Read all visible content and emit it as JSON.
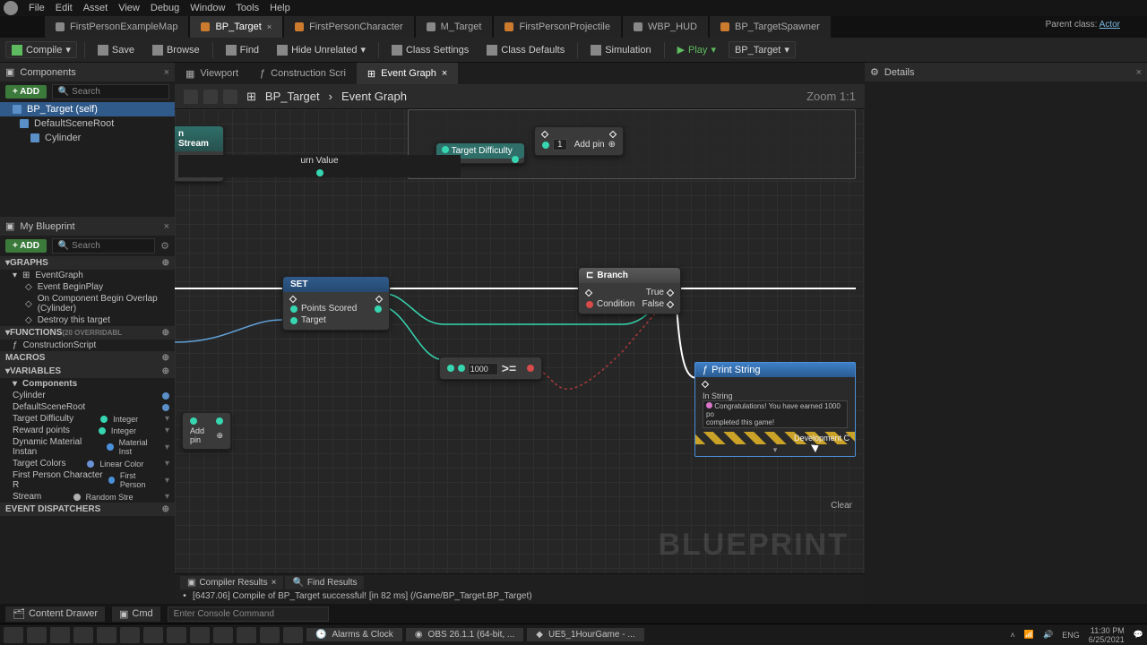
{
  "menu": [
    "File",
    "Edit",
    "Asset",
    "View",
    "Debug",
    "Window",
    "Tools",
    "Help"
  ],
  "tabs": [
    {
      "label": "FirstPersonExampleMap"
    },
    {
      "label": "BP_Target",
      "active": true,
      "closable": true
    },
    {
      "label": "FirstPersonCharacter"
    },
    {
      "label": "M_Target"
    },
    {
      "label": "FirstPersonProjectile"
    },
    {
      "label": "WBP_HUD"
    },
    {
      "label": "BP_TargetSpawner"
    }
  ],
  "parentclass": {
    "label": "Parent class:",
    "value": "Actor"
  },
  "toolbar": {
    "compile": "Compile",
    "save": "Save",
    "browse": "Browse",
    "find": "Find",
    "hide": "Hide Unrelated",
    "class_settings": "Class Settings",
    "class_defaults": "Class Defaults",
    "simulation": "Simulation",
    "play": "Play",
    "target_select": "BP_Target"
  },
  "components": {
    "title": "Components",
    "add": "ADD",
    "search_ph": "Search",
    "items": [
      {
        "label": "BP_Target (self)"
      },
      {
        "label": "DefaultSceneRoot"
      },
      {
        "label": "Cylinder",
        "indent": true
      }
    ]
  },
  "myblueprint": {
    "title": "My Blueprint",
    "add": "ADD",
    "search_ph": "Search",
    "graphs": {
      "head": "GRAPHS",
      "items": [
        "EventGraph",
        "Event BeginPlay",
        "On Component Begin Overlap (Cylinder)",
        "Destroy this target"
      ]
    },
    "functions": {
      "head": "FUNCTIONS",
      "hint": "(20 OVERRIDABL",
      "items": [
        "ConstructionScript"
      ]
    },
    "macros": {
      "head": "MACROS"
    },
    "variables": {
      "head": "VARIABLES",
      "comp": {
        "head": "Components",
        "items": [
          "Cylinder",
          "DefaultSceneRoot"
        ]
      },
      "vars": [
        {
          "name": "Target Difficulty",
          "type": "Integer",
          "dot": "int"
        },
        {
          "name": "Reward points",
          "type": "Integer",
          "dot": "int"
        },
        {
          "name": "Dynamic Material Instan",
          "type": "Material Inst",
          "dot": "obj"
        },
        {
          "name": "Target Colors",
          "type": "Linear Color",
          "dot": "linear"
        },
        {
          "name": "First Person Character R",
          "type": "First Person",
          "dot": "obj"
        },
        {
          "name": "Stream",
          "type": "Random Stre",
          "dot": "stream"
        }
      ]
    },
    "dispatchers": {
      "head": "EVENT DISPATCHERS"
    }
  },
  "subtabs": [
    {
      "label": "Viewport"
    },
    {
      "label": "Construction Scri"
    },
    {
      "label": "Event Graph",
      "active": true,
      "closable": true
    }
  ],
  "breadcrumb": {
    "a": "BP_Target",
    "b": "Event Graph",
    "zoom": "Zoom 1:1"
  },
  "graph_top": {
    "difficulty": "Target Difficulty",
    "addpin": "Add pin",
    "stream": "n Stream",
    "urn": "urn Value"
  },
  "nodes": {
    "set": {
      "title": "SET",
      "pins": [
        "Points Scored",
        "Target"
      ]
    },
    "branch": {
      "title": "Branch",
      "true": "True",
      "false": "False",
      "cond": "Condition"
    },
    "cmp": {
      "op": ">=",
      "value": "1000"
    },
    "addpin": "Add pin",
    "print": {
      "title": "Print String",
      "in": "In String",
      "msg": "Congratulations! You have earned 1000 po",
      "msg2": "completed this game!",
      "dev": "Development C"
    }
  },
  "bp_water": "BLUEPRINT",
  "compiler": {
    "tab1": "Compiler Results",
    "tab2": "Find Results",
    "msg": "[6437.06] Compile of BP_Target successful! [in 82 ms] (/Game/BP_Target.BP_Target)",
    "clear": "Clear"
  },
  "details": {
    "title": "Details"
  },
  "footer": {
    "drawer": "Content Drawer",
    "cmd": "Cmd",
    "console_ph": "Enter Console Command"
  },
  "taskbar": {
    "items": [
      "Alarms & Clock",
      "OBS 26.1.1 (64-bit, ...",
      "UE5_1HourGame - ..."
    ],
    "lang": "ENG",
    "time": "11:30 PM",
    "date": "6/25/2021"
  }
}
